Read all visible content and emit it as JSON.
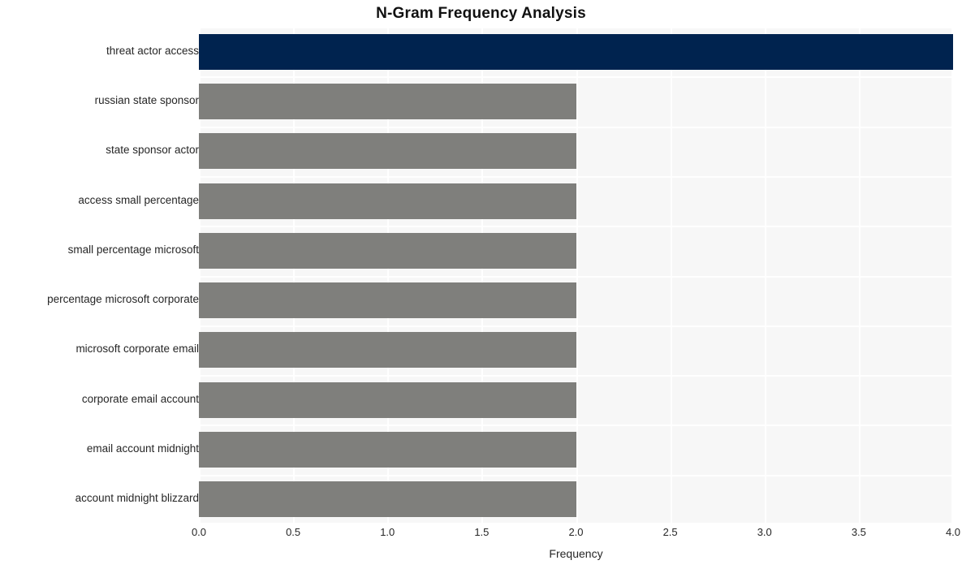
{
  "chart_data": {
    "type": "bar",
    "orientation": "horizontal",
    "title": "N-Gram Frequency Analysis",
    "xlabel": "Frequency",
    "ylabel": "",
    "xlim": [
      0,
      4
    ],
    "xticks": [
      "0.0",
      "0.5",
      "1.0",
      "1.5",
      "2.0",
      "2.5",
      "3.0",
      "3.5",
      "4.0"
    ],
    "xtick_values": [
      0,
      0.5,
      1,
      1.5,
      2,
      2.5,
      3,
      3.5,
      4
    ],
    "grid": true,
    "legend": "none",
    "categories": [
      "threat actor access",
      "russian state sponsor",
      "state sponsor actor",
      "access small percentage",
      "small percentage microsoft",
      "percentage microsoft corporate",
      "microsoft corporate email",
      "corporate email account",
      "email account midnight",
      "account midnight blizzard"
    ],
    "values": [
      4,
      2,
      2,
      2,
      2,
      2,
      2,
      2,
      2,
      2
    ],
    "bar_colors": [
      "#00234f",
      "#7f7f7c",
      "#7f7f7c",
      "#7f7f7c",
      "#7f7f7c",
      "#7f7f7c",
      "#7f7f7c",
      "#7f7f7c",
      "#7f7f7c",
      "#7f7f7c"
    ],
    "plot_background": "#f7f7f7",
    "gridline_color": "#ffffff",
    "figure_background": "#ffffff",
    "highlight_color": "#00234f",
    "default_bar_color": "#7f7f7c"
  }
}
